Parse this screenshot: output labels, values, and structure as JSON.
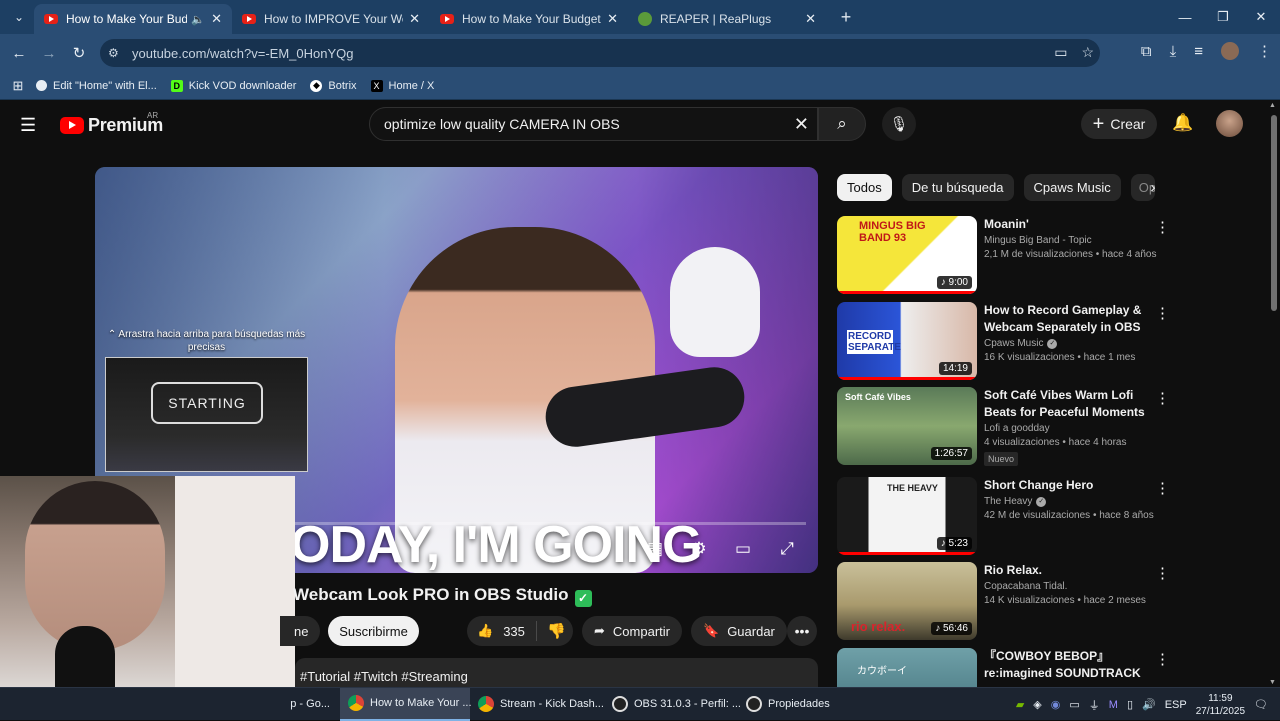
{
  "browser": {
    "tabs": [
      {
        "title": "How to Make Your Budget ",
        "active": true,
        "icon": "youtube-icon",
        "audio": true
      },
      {
        "title": "How to IMPROVE Your Webcam",
        "active": false,
        "icon": "youtube-icon"
      },
      {
        "title": "How to Make Your Budget Mic",
        "active": false,
        "icon": "youtube-icon"
      },
      {
        "title": "REAPER | ReaPlugs",
        "active": false,
        "icon": "reaper-icon"
      }
    ],
    "url": "youtube.com/watch?v=-EM_0HonYQg",
    "bookmarks": [
      {
        "label": "Edit \"Home\" with El...",
        "icon": "bookmark-icon"
      },
      {
        "label": "Kick VOD downloader",
        "icon": "kick-icon"
      },
      {
        "label": "Botrix",
        "icon": "botrix-icon"
      },
      {
        "label": "Home / X",
        "icon": "x-icon"
      }
    ]
  },
  "youtube": {
    "logo_text": "Premium",
    "region": "AR",
    "search_value": "optimize low quality CAMERA IN OBS",
    "create_label": "Crear"
  },
  "player": {
    "caption": "ODAY, I'M GOING",
    "swipe_hint": "⌃ Arrastra hacia arriba para búsquedas más precisas",
    "mini_text": "STARTING"
  },
  "video": {
    "title": "Webcam Look PRO in OBS Studio",
    "join_label": "ne",
    "subscribe_label": "Suscribirme",
    "likes": "335",
    "share_label": "Compartir",
    "save_label": "Guardar",
    "description_tags": "#Tutorial #Twitch #Streaming"
  },
  "sidebar": {
    "chips": [
      "Todos",
      "De tu búsqueda",
      "Cpaws Music",
      "Op"
    ],
    "recommendations": [
      {
        "title": "Moanin'",
        "channel": "Mingus Big Band - Topic",
        "verified": false,
        "meta": "2,1 M de visualizaciones • hace 4 años",
        "duration": "9:00",
        "thumb_text": "MINGUS BIG BAND 93",
        "music": true,
        "badge": ""
      },
      {
        "title": "How to Record Gameplay & Webcam Separately in OBS ...",
        "channel": "Cpaws Music",
        "verified": true,
        "meta": "16 K visualizaciones • hace 1 mes",
        "duration": "14:19",
        "thumb_text": "RECORD SEPARATE",
        "music": false,
        "badge": ""
      },
      {
        "title": "Soft Café Vibes Warm Lofi Beats for Peaceful Moments |...",
        "channel": "Lofi a goodday",
        "verified": false,
        "meta": "4 visualizaciones • hace 4 horas",
        "duration": "1:26:57",
        "thumb_text": "Soft Café Vibes",
        "music": false,
        "badge": "Nuevo"
      },
      {
        "title": "Short Change Hero",
        "channel": "The Heavy",
        "verified": true,
        "meta": "42 M de visualizaciones • hace 8 años",
        "duration": "5:23",
        "thumb_text": "THE HEAVY",
        "music": true,
        "badge": ""
      },
      {
        "title": "Rio Relax.",
        "channel": "Copacabana Tidal.",
        "verified": false,
        "meta": "14 K visualizaciones • hace 2 meses",
        "duration": "56:46",
        "thumb_text": "rio relax.",
        "music": true,
        "badge": ""
      },
      {
        "title": "『COWBOY BEBOP』 re:imagined SOUNDTRACK",
        "channel": "",
        "verified": false,
        "meta": "",
        "duration": "",
        "thumb_text": "カウボーイ",
        "music": false,
        "badge": ""
      }
    ]
  },
  "taskbar": {
    "items": [
      {
        "label": "p - Go...",
        "active": false
      },
      {
        "label": "How to Make Your ...",
        "active": true
      },
      {
        "label": "Stream - Kick Dash...",
        "active": false
      },
      {
        "label": "OBS 31.0.3 - Perfil: ...",
        "active": false
      },
      {
        "label": "Propiedades",
        "active": false
      }
    ],
    "lang": "ESP",
    "time": "11:59",
    "date": "27/11/2025"
  }
}
